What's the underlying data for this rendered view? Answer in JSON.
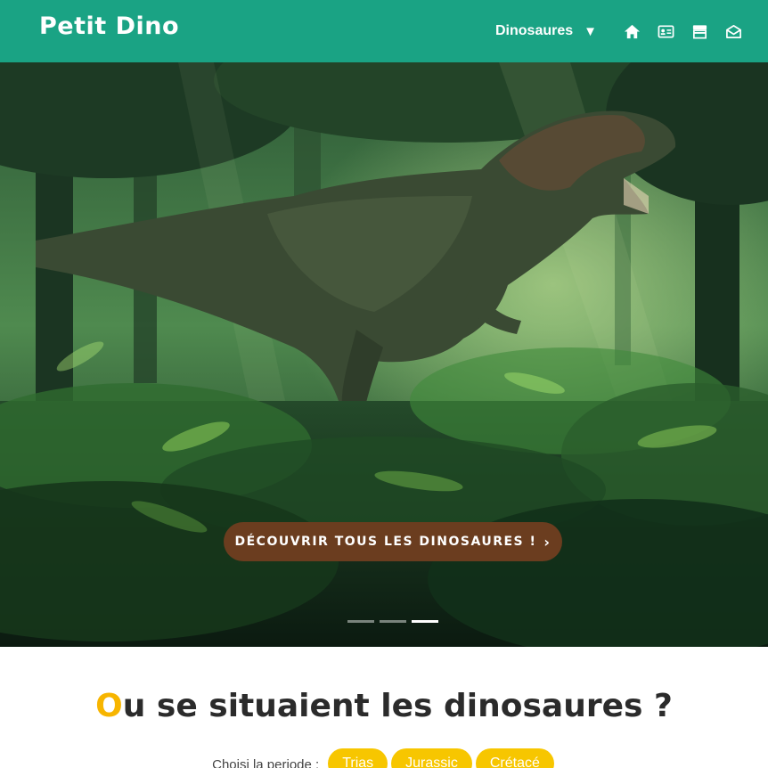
{
  "header": {
    "logo": "Petit Dino",
    "nav_dinosaures": "Dinosaures",
    "caret": "▼",
    "icons": [
      "home-icon",
      "id-card-icon",
      "shop-icon",
      "mail-icon"
    ]
  },
  "hero": {
    "cta_label": "DÉCOUVRIR TOUS LES DINOSAURES !",
    "cta_chevron": "›",
    "slides_total": 3,
    "active_slide": 3
  },
  "section": {
    "title_first_letter": "O",
    "title_rest": "u se situaient les dinosaures ?",
    "filter_label": "Choisi la periode :",
    "periods": [
      "Trias",
      "Jurassic",
      "Crétacé"
    ]
  },
  "colors": {
    "header_bg": "#1aa384",
    "cta_bg": "#6b3d1f",
    "accent_yellow": "#f7c600"
  }
}
